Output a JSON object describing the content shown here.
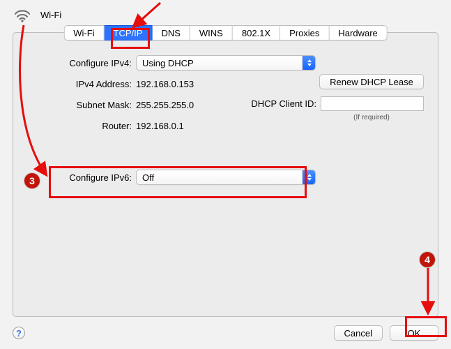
{
  "header": {
    "title": "Wi-Fi"
  },
  "tabs": [
    "Wi-Fi",
    "TCP/IP",
    "DNS",
    "WINS",
    "802.1X",
    "Proxies",
    "Hardware"
  ],
  "active_tab_index": 1,
  "ipv4": {
    "configure_label": "Configure IPv4:",
    "configure_value": "Using DHCP",
    "address_label": "IPv4 Address:",
    "address_value": "192.168.0.153",
    "subnet_label": "Subnet Mask:",
    "subnet_value": "255.255.255.0",
    "router_label": "Router:",
    "router_value": "192.168.0.1",
    "renew_label": "Renew DHCP Lease",
    "clientid_label": "DHCP Client ID:",
    "clientid_value": "",
    "if_required": "(If required)"
  },
  "ipv6": {
    "configure_label": "Configure IPv6:",
    "configure_value": "Off"
  },
  "footer": {
    "help": "?",
    "cancel": "Cancel",
    "ok": "OK"
  },
  "annotations": {
    "badge3": "3",
    "badge4": "4"
  },
  "colors": {
    "accent": "#2d73ff",
    "annot_red": "#e60d0d",
    "badge_red": "#c1140a"
  }
}
